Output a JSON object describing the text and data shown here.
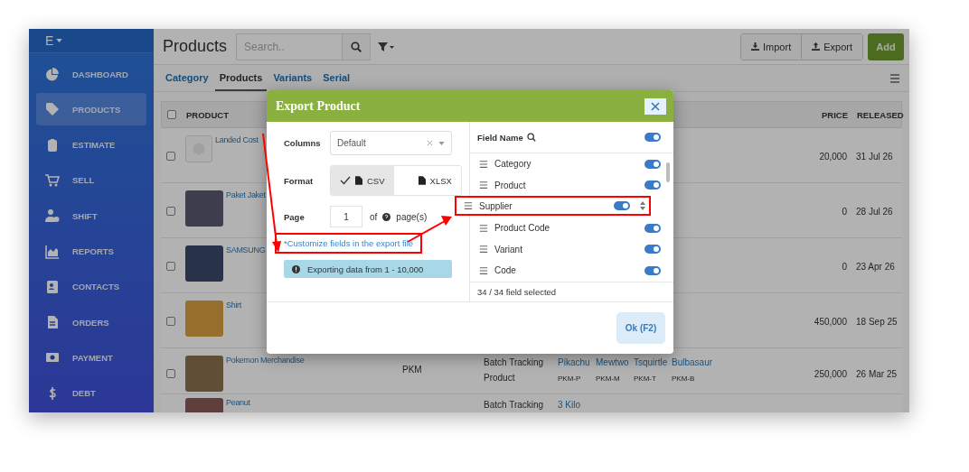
{
  "sidebar": {
    "brand": "E",
    "items": [
      {
        "label": "DASHBOARD",
        "selected": false
      },
      {
        "label": "PRODUCTS",
        "selected": true
      },
      {
        "label": "ESTIMATE",
        "selected": false
      },
      {
        "label": "SELL",
        "selected": false
      },
      {
        "label": "SHIFT",
        "selected": false
      },
      {
        "label": "REPORTS",
        "selected": false
      },
      {
        "label": "CONTACTS",
        "selected": false
      },
      {
        "label": "ORDERS",
        "selected": false
      },
      {
        "label": "PAYMENT",
        "selected": false
      },
      {
        "label": "DEBT",
        "selected": false
      }
    ]
  },
  "header": {
    "title": "Products",
    "search": {
      "placeholder": "Search.."
    },
    "buttons": [
      "Import",
      "Export"
    ],
    "add_button": "Add"
  },
  "tabs": [
    {
      "label": "Category",
      "selected": false
    },
    {
      "label": "Products",
      "selected": true
    },
    {
      "label": "Variants",
      "selected": false
    },
    {
      "label": "Serial",
      "selected": false
    }
  ],
  "table": {
    "all_checked": false,
    "columns": [
      "PRODUCT",
      "PRICE",
      "RELEASED"
    ],
    "rows": [
      {
        "checked": false,
        "name": "Landed Cost",
        "price": "20,000",
        "released": "31 Jul 26"
      },
      {
        "checked": false,
        "name": "Paket Jaket",
        "price": "0",
        "released": "28 Jul 26"
      },
      {
        "checked": false,
        "name": "SAMSUNG",
        "price": "0",
        "released": "23 Apr 26"
      },
      {
        "checked": false,
        "name": "Shirt",
        "price": "450,000",
        "released": "18 Sep 25"
      },
      {
        "checked": false,
        "name": "Pokemon Merchandise",
        "code": "PKM",
        "details": [
          {
            "label": "Batch Tracking",
            "values": [
              "Pikachu",
              "Mewtwo",
              "Tsquirtle",
              "Bulbasaur"
            ],
            "kind": "link"
          },
          {
            "label": "Product",
            "values": [
              "PKM-P",
              "PKM-M",
              "PKM-T",
              "PKM-B"
            ],
            "kind": "code"
          }
        ],
        "price": "250,000",
        "released": "26 Mar 25"
      },
      {
        "name": "Peanut",
        "details": [
          {
            "label": "Batch Tracking",
            "values": [
              "3 Kilo"
            ],
            "kind": "link"
          }
        ]
      }
    ]
  },
  "dialog": {
    "title": "Export Product",
    "columns": {
      "label": "Columns",
      "value": "Default"
    },
    "format": {
      "label": "Format",
      "options": [
        {
          "label": "CSV",
          "selected": true
        },
        {
          "label": "XLSX",
          "selected": false
        }
      ]
    },
    "page": {
      "label": "Page",
      "value": "1",
      "of": "of",
      "suffix": "page(s)"
    },
    "customize_link": "*Customize fields in the export file",
    "info": "Exporting data from 1 - 10,000",
    "fields": {
      "header": "Field Name",
      "all_on": true,
      "items": [
        {
          "name": "Category",
          "on": true,
          "dragging": false
        },
        {
          "name": "Product",
          "on": true,
          "dragging": false
        },
        {
          "name": "Supplier",
          "on": true,
          "dragging": true
        },
        {
          "name": "Product Code",
          "on": true,
          "dragging": false
        },
        {
          "name": "Variant",
          "on": true,
          "dragging": false
        },
        {
          "name": "Code",
          "on": true,
          "dragging": false
        }
      ],
      "summary": "34 / 34 field selected"
    },
    "ok_button": "Ok (F2)"
  }
}
